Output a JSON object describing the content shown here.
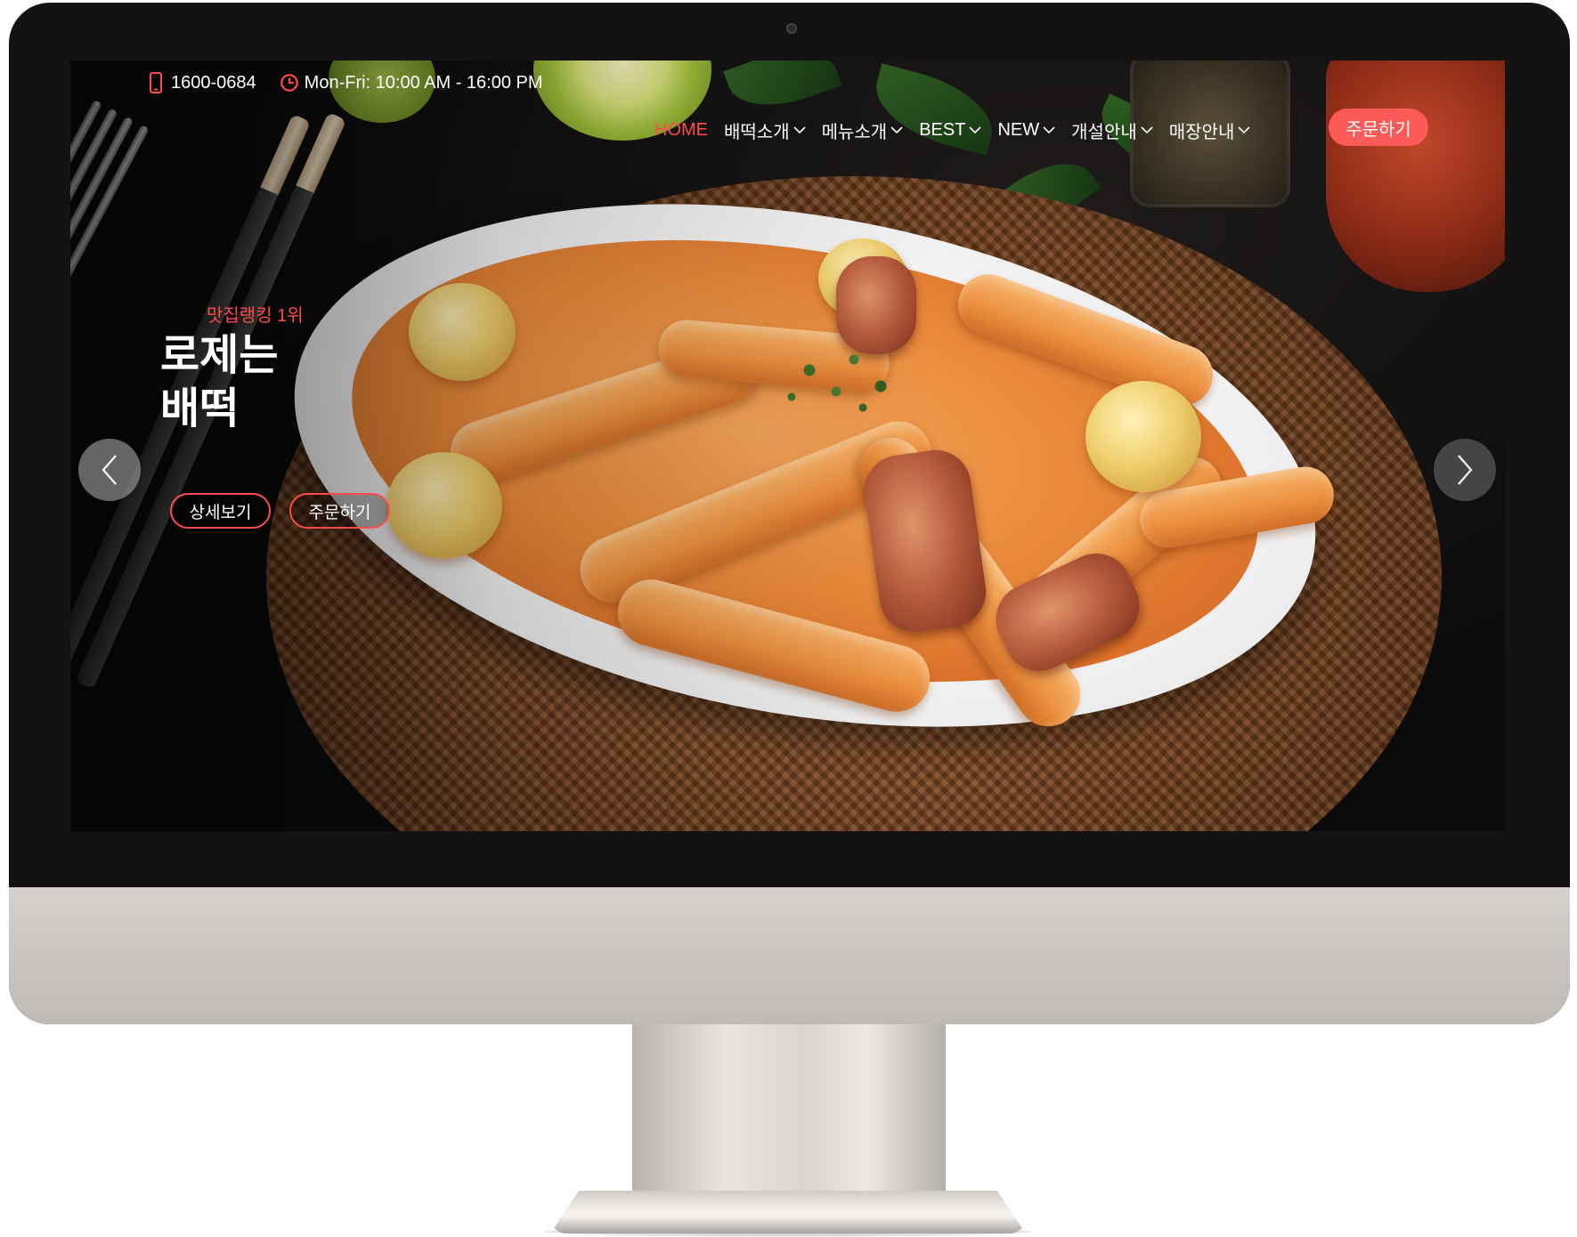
{
  "topbar": {
    "phone_icon": "mobile-phone-icon",
    "phone": "1600-0684",
    "hours_icon": "clock-icon",
    "hours": "Mon-Fri: 10:00 AM - 16:00 PM"
  },
  "nav": {
    "items": [
      {
        "label": "HOME",
        "active": true,
        "dropdown": false
      },
      {
        "label": "배떡소개",
        "active": false,
        "dropdown": true
      },
      {
        "label": "메뉴소개",
        "active": false,
        "dropdown": true
      },
      {
        "label": "BEST",
        "active": false,
        "dropdown": true
      },
      {
        "label": "NEW",
        "active": false,
        "dropdown": true
      },
      {
        "label": "개설안내",
        "active": false,
        "dropdown": true
      },
      {
        "label": "매장안내",
        "active": false,
        "dropdown": true
      }
    ],
    "order_button": "주문하기"
  },
  "hero": {
    "ranking": "맛집랭킹 1위",
    "title_line1": "로제는",
    "title_line2": "배떡",
    "detail_button": "상세보기",
    "order_button": "주문하기",
    "prev_icon": "chevron-left-icon",
    "next_icon": "chevron-right-icon"
  },
  "colors": {
    "accent": "#ff4b4b",
    "order_button_bg": "#ff5a5a",
    "monitor_bezel": "#141212",
    "monitor_chin": "#cbc6c1"
  }
}
